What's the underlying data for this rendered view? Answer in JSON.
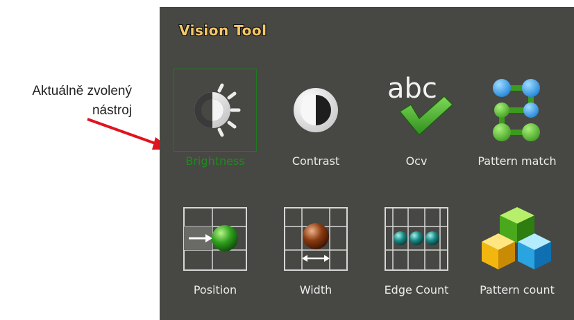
{
  "annotation": {
    "line1": "Aktuálně zvolený",
    "line2": "nástroj"
  },
  "panel": {
    "title": "Vision Tool"
  },
  "tools": [
    {
      "label": "Brightness",
      "icon": "brightness-icon",
      "selected": true
    },
    {
      "label": "Contrast",
      "icon": "contrast-icon",
      "selected": false
    },
    {
      "label": "Ocv",
      "icon": "ocv-icon",
      "selected": false
    },
    {
      "label": "Pattern match",
      "icon": "pattern-match-icon",
      "selected": false
    },
    {
      "label": "Position",
      "icon": "position-icon",
      "selected": false
    },
    {
      "label": "Width",
      "icon": "width-icon",
      "selected": false
    },
    {
      "label": "Edge Count",
      "icon": "edge-count-icon",
      "selected": false
    },
    {
      "label": "Pattern count",
      "icon": "pattern-count-icon",
      "selected": false
    }
  ],
  "colors": {
    "panel_bg": "#474843",
    "title": "#f5c76a",
    "selected": "#1f8a1f",
    "arrow": "#e0141e"
  }
}
